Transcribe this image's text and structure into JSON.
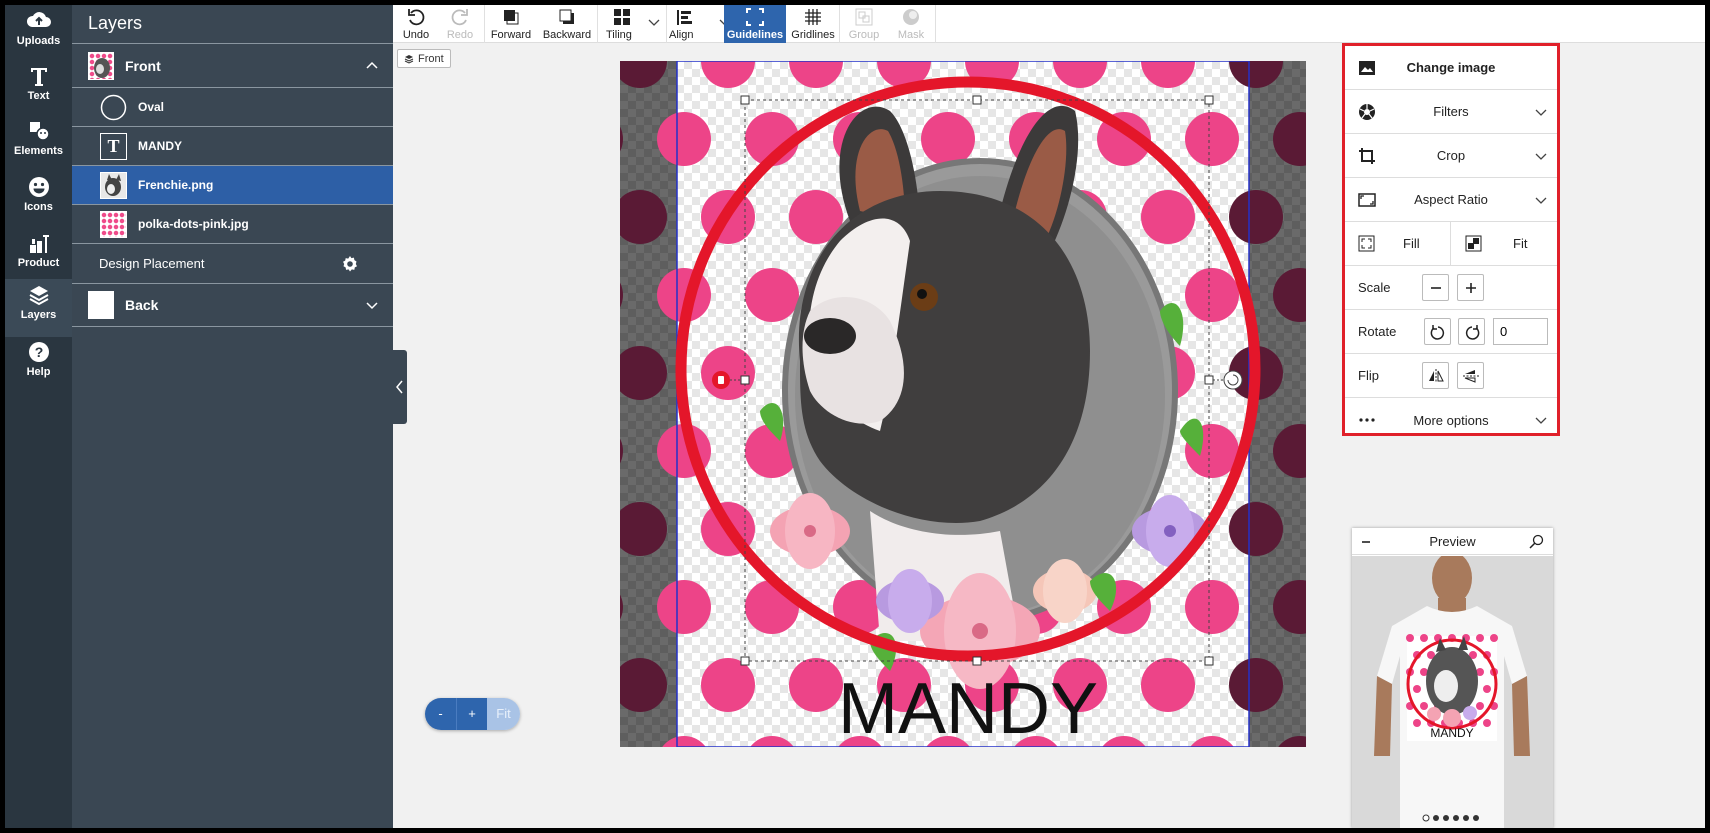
{
  "rail": {
    "items": [
      {
        "label": "Uploads",
        "icon": "cloud-upload-icon"
      },
      {
        "label": "Text",
        "icon": "text-icon"
      },
      {
        "label": "Elements",
        "icon": "elements-icon"
      },
      {
        "label": "Icons",
        "icon": "smiley-icon"
      },
      {
        "label": "Product",
        "icon": "product-icon"
      },
      {
        "label": "Layers",
        "icon": "layers-icon"
      },
      {
        "label": "Help",
        "icon": "help-icon"
      }
    ],
    "active": "Layers"
  },
  "layers": {
    "title": "Layers",
    "front_group": "Front",
    "items": [
      {
        "label": "Oval",
        "thumb": "circle-outline"
      },
      {
        "label": "MANDY",
        "thumb": "text-T"
      },
      {
        "label": "Frenchie.png",
        "thumb": "dog-photo",
        "selected": true
      },
      {
        "label": "polka-dots-pink.jpg",
        "thumb": "polka-dots"
      }
    ],
    "design_placement": "Design Placement",
    "back_group": "Back"
  },
  "toolbar": {
    "undo": "Undo",
    "redo": "Redo",
    "forward": "Forward",
    "backward": "Backward",
    "tiling": "Tiling",
    "align": "Align",
    "guidelines": "Guidelines",
    "gridlines": "Gridlines",
    "group": "Group",
    "mask": "Mask"
  },
  "canvas": {
    "side_tag": "Front",
    "text": "MANDY",
    "colors": {
      "dot_pink": "#ed4488",
      "ring_red": "#e4162a",
      "dark_dot": "#5a1a35"
    }
  },
  "zoom": {
    "minus": "-",
    "plus": "+",
    "fit": "Fit"
  },
  "props": {
    "change_image": "Change image",
    "filters": "Filters",
    "crop": "Crop",
    "aspect_ratio": "Aspect Ratio",
    "fill": "Fill",
    "fit": "Fit",
    "scale": "Scale",
    "rotate": "Rotate",
    "rotate_value": "0",
    "flip": "Flip",
    "more_options": "More options"
  },
  "preview": {
    "title": "Preview",
    "text": "MANDY"
  }
}
